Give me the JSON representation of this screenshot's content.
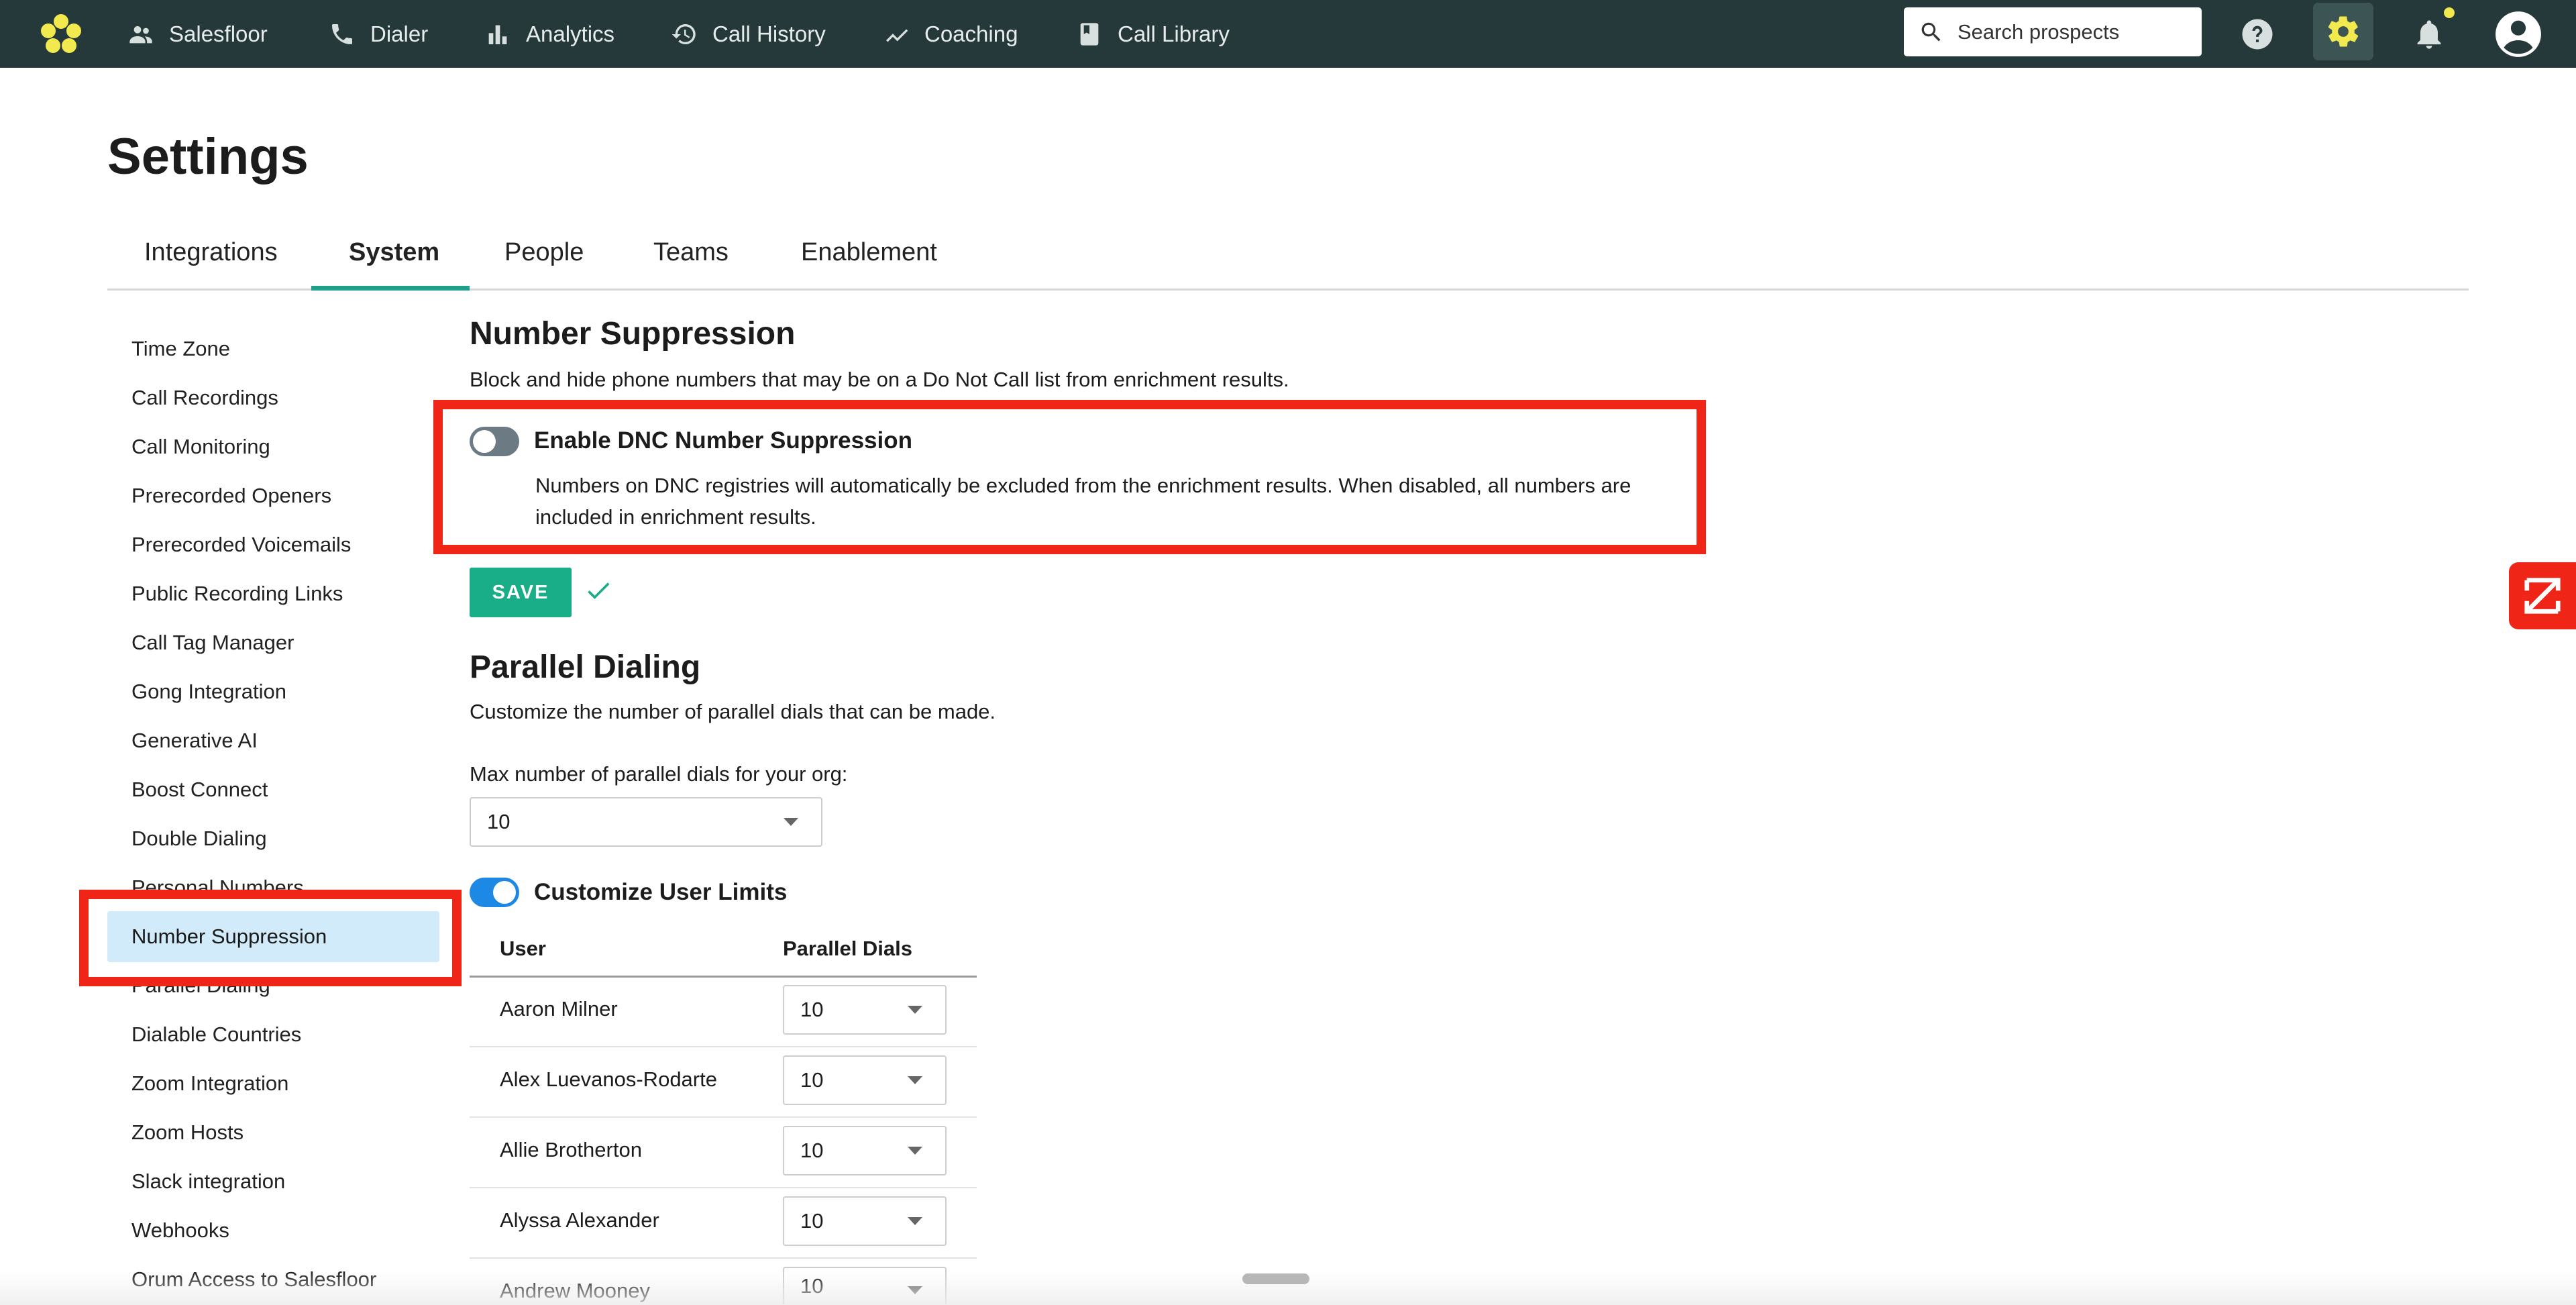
{
  "nav": {
    "items": [
      {
        "label": "Salesfloor",
        "icon": "people-icon"
      },
      {
        "label": "Dialer",
        "icon": "phone-icon"
      },
      {
        "label": "Analytics",
        "icon": "bar-chart-icon"
      },
      {
        "label": "Call History",
        "icon": "history-icon"
      },
      {
        "label": "Coaching",
        "icon": "trend-icon"
      },
      {
        "label": "Call Library",
        "icon": "book-icon"
      }
    ],
    "search_placeholder": "Search prospects",
    "accent_color": "#f2e94e",
    "bar_color": "#26393a"
  },
  "page": {
    "title": "Settings",
    "tabs": [
      "Integrations",
      "System",
      "People",
      "Teams",
      "Enablement"
    ],
    "active_tab": "System"
  },
  "sidebar": {
    "items": [
      "Time Zone",
      "Call Recordings",
      "Call Monitoring",
      "Prerecorded Openers",
      "Prerecorded Voicemails",
      "Public Recording Links",
      "Call Tag Manager",
      "Gong Integration",
      "Generative AI",
      "Boost Connect",
      "Double Dialing",
      "Personal Numbers",
      "Number Suppression",
      "Parallel Dialing",
      "Dialable Countries",
      "Zoom Integration",
      "Zoom Hosts",
      "Slack integration",
      "Webhooks",
      "Orum Access to Salesfloor"
    ],
    "active_item": "Number Suppression"
  },
  "number_suppression": {
    "heading": "Number Suppression",
    "description": "Block and hide phone numbers that may be on a Do Not Call list from enrichment results.",
    "toggle_label": "Enable DNC Number Suppression",
    "toggle_on": false,
    "toggle_help": "Numbers on DNC registries will automatically be excluded from the enrichment results. When disabled, all numbers are included in enrichment results.",
    "save_label": "SAVE"
  },
  "parallel_dialing": {
    "heading": "Parallel Dialing",
    "description": "Customize the number of parallel dials that can be made.",
    "max_label": "Max number of parallel dials for your org:",
    "max_value": "10",
    "customize_label": "Customize User Limits",
    "customize_on": true,
    "table": {
      "headers": [
        "User",
        "Parallel Dials"
      ],
      "rows": [
        {
          "user": "Aaron Milner",
          "dials": "10"
        },
        {
          "user": "Alex Luevanos-Rodarte",
          "dials": "10"
        },
        {
          "user": "Allie Brotherton",
          "dials": "10"
        },
        {
          "user": "Alyssa Alexander",
          "dials": "10"
        },
        {
          "user": "Andrew Mooney",
          "dials": "10"
        }
      ]
    }
  },
  "colors": {
    "save_button": "#1aae88",
    "tab_underline": "#1ca288",
    "active_sidebar": "#d2ebfb",
    "annotation_red": "#ee2517",
    "toggle_on": "#1e88e5"
  }
}
